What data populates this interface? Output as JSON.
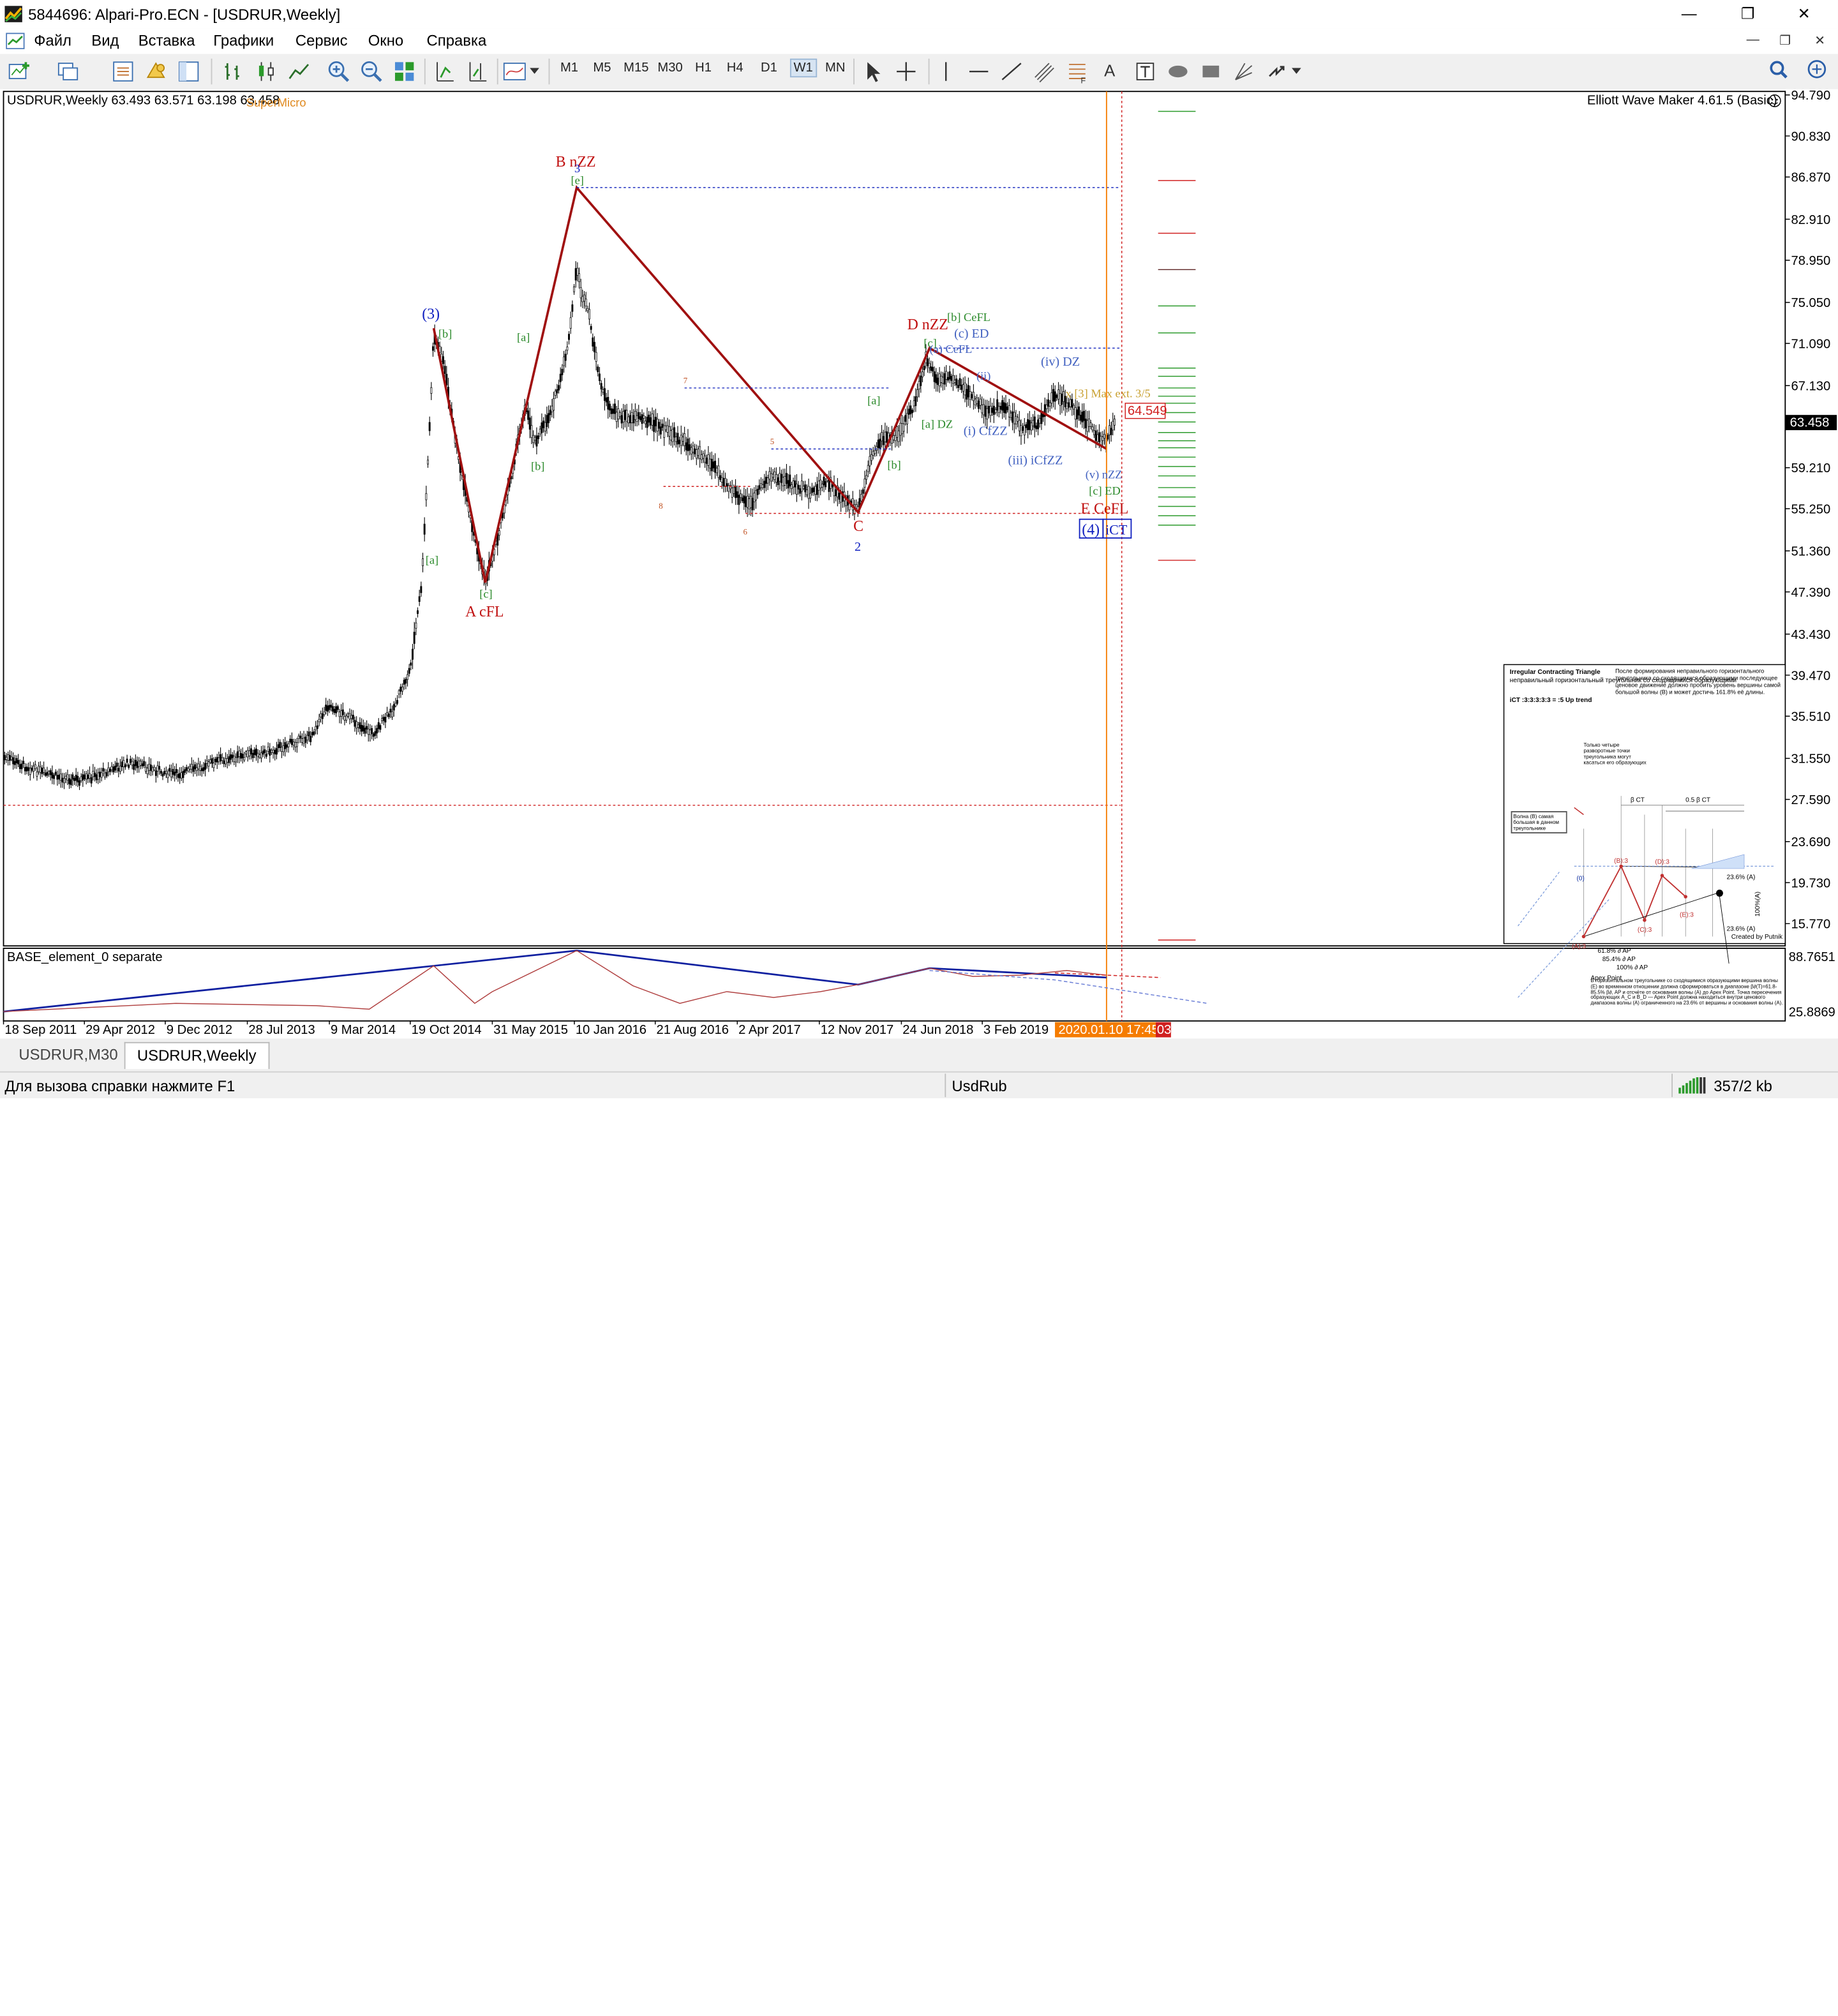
{
  "window": {
    "title": "5844696: Alpari-Pro.ECN - [USDRUR,Weekly]",
    "minimize": "—",
    "restore": "❐",
    "close": "✕"
  },
  "menu": {
    "items": [
      "Файл",
      "Вид",
      "Вставка",
      "Графики",
      "Сервис",
      "Окно",
      "Справка"
    ],
    "mdi_min": "—",
    "mdi_restore": "❐",
    "mdi_close": "✕"
  },
  "toolbar": {
    "timeframes": [
      "M1",
      "M5",
      "M15",
      "M30",
      "H1",
      "H4",
      "D1",
      "W1",
      "MN"
    ],
    "active_timeframe": "W1",
    "draw_text_tool": "A"
  },
  "chart": {
    "header": "USDRUR,Weekly  63.493 63.571 63.198 63.458",
    "indicator_label": "SuperMicro",
    "ewm_label": "Elliott Wave Maker 4.61.5 (Basic)",
    "price_labels": [
      "94.790",
      "90.830",
      "86.870",
      "82.910",
      "78.950",
      "75.050",
      "71.090",
      "67.130",
      "63.458",
      "59.210",
      "55.250",
      "51.360",
      "47.390",
      "43.430",
      "39.470",
      "35.510",
      "31.550",
      "27.590",
      "23.690",
      "19.730",
      "15.770"
    ],
    "current_price": "63.458",
    "line_price": "64.549",
    "sub_header": "BASE_element_0 separate",
    "sub_prices": [
      "88.7651",
      "25.8869"
    ],
    "x_labels": [
      "18 Sep 2011",
      "29 Apr 2012",
      "9 Dec 2012",
      "28 Jul 2013",
      "9 Mar 2014",
      "19 Oct 2014",
      "31 May 2015",
      "10 Jan 2016",
      "21 Aug 2016",
      "2 Apr 2017",
      "12 Nov 2017",
      "24 Jun 2018",
      "3 Feb 2019"
    ],
    "cursor_time": "2020.01.10 17:45",
    "cursor_time_suffix": "03",
    "waves": {
      "w3": "(3)",
      "b3": "[b]",
      "a3": "[a]",
      "wa": "[a]",
      "wb": "[b]",
      "wc": "[c]",
      "A": "A cFL",
      "B": "B nZZ",
      "Be": "[e]",
      "B3": "3",
      "C": "C",
      "C2": "2",
      "D": "D nZZ",
      "Dc": "[c]",
      "Db": "[b] CeFL",
      "DcED": "(c) ED",
      "DaCeFL": "(a) CeFL",
      "Da": "[a]",
      "Db2": "[b]",
      "DaDZ": "[a] DZ",
      "ivDZ": "(iv) DZ",
      "iCfZZ": "(i) CfZZ",
      "iiiCfZZ": "(iii) iCfZZ",
      "ii": "(ii)",
      "E": "E CeFL",
      "EcED": "[c] ED",
      "vZZ": "(v) nZZ",
      "w4": "(4)",
      "w4iCT": "iCT",
      "x3": "x [3] Max ext. 3/5",
      "n7": "7",
      "n5": "5",
      "n8": "8",
      "n6": "6"
    }
  },
  "info_panel": {
    "title": "Irregular Contracting Triangle",
    "subtitle": "неправильный горизонтальный треугольник со сходящимися образующими",
    "formula": "iCT :3:3:3:3:3 = :5 Up trend",
    "desc": "После формирования неправильного горизонтального треугольника со сходящимися образующими последующее ценовое движение должно пробить уровень вершины самой большой волны (B) и может достичь 161.8% её длины.",
    "note": "Только четыре разворотные точки треугольника могут касаться его образующих",
    "side_note": "Волна (B) самая большая в данном треугольнике",
    "labels": [
      "(0)",
      "(A):3",
      "(B):3",
      "(C):3",
      "(D):3",
      "(E):3"
    ],
    "fib": [
      "23.6% (A)",
      "61.8% ∂ AP",
      "85.4% ∂ AP",
      "100% ∂ AP",
      "β CT",
      "0.5 β CT",
      "100%(A)"
    ],
    "apex": "Apex Point",
    "bottom_text": "В горизонтальном треугольнике со сходящимися образующими вершина волны (E) во временном отношении должна сформироваться в диапазоне β∂(T)=61.8-85.5% β∂, AP и отсчёте от основания волны (A) до Apex Point. Точка пересечения образующих A_C и B_D — Apex Point должна находиться внутри ценового диапазона волны (A) ограниченного на 23.6% от вершины и основания волны (A).",
    "credit": "Created by Putnik"
  },
  "tabs": [
    "USDRUR,M30",
    "USDRUR,Weekly"
  ],
  "active_tab": "USDRUR,Weekly",
  "status": {
    "help": "Для вызова справки нажмите F1",
    "profile": "UsdRub",
    "traffic": "357/2 kb"
  }
}
